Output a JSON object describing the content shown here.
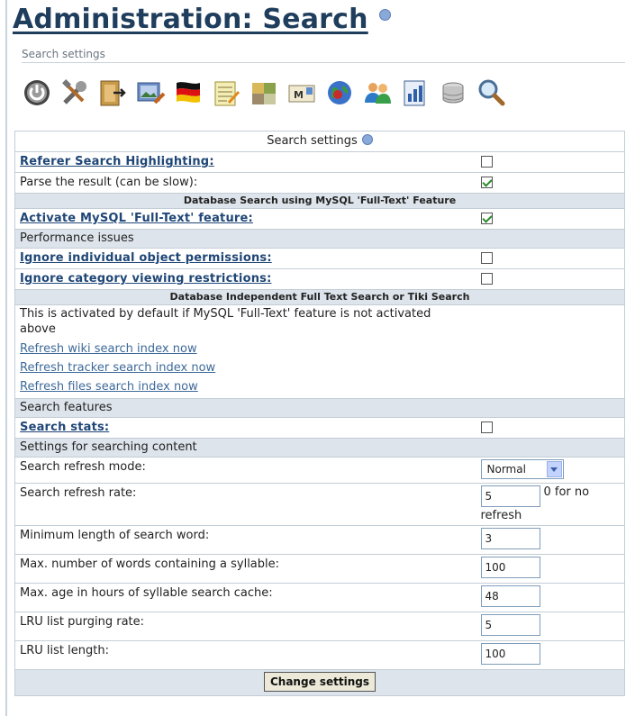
{
  "page": {
    "title": "Administration: Search",
    "subtitle": "Search settings"
  },
  "icon_bar": [
    "power-icon",
    "tools-icon",
    "door-login-icon",
    "image-edit-icon",
    "language-flag-icon",
    "notepad-icon",
    "map-puzzle-icon",
    "mail-icon",
    "globe-icon",
    "users-icon",
    "document-stats-icon",
    "stacked-disks-icon",
    "search-magnifier-icon"
  ],
  "form": {
    "caption": "Search settings",
    "referer_highlighting": {
      "label": "Referer Search Highlighting:",
      "checked": false
    },
    "parse_result": {
      "label": "Parse the result (can be slow):",
      "checked": true
    },
    "mysql_heading": "Database Search using MySQL 'Full-Text' Feature",
    "activate_fulltext": {
      "label": "Activate MySQL 'Full-Text' feature:",
      "checked": true
    },
    "performance_heading": "Performance issues",
    "ignore_object_perms": {
      "label": "Ignore individual object permissions:",
      "checked": false
    },
    "ignore_category_restrictions": {
      "label": "Ignore category viewing restrictions:",
      "checked": false
    },
    "independent_heading": "Database Independent Full Text Search or Tiki Search",
    "independent_note": "This is activated by default if MySQL 'Full-Text' feature is not activated above",
    "refresh_links": [
      "Refresh wiki search index now",
      "Refresh tracker search index now",
      "Refresh files search index now"
    ],
    "features_heading": "Search features",
    "search_stats": {
      "label": "Search stats:",
      "checked": false
    },
    "content_heading": "Settings for searching content",
    "refresh_mode": {
      "label": "Search refresh mode:",
      "value": "Normal"
    },
    "refresh_rate": {
      "label": "Search refresh rate:",
      "value": "5",
      "hint": "0 for no refresh"
    },
    "min_word_length": {
      "label": "Minimum length of search word:",
      "value": "3"
    },
    "max_words_syllable": {
      "label": "Max. number of words containing a syllable:",
      "value": "100"
    },
    "max_age_cache": {
      "label": "Max. age in hours of syllable search cache:",
      "value": "48"
    },
    "lru_purge_rate": {
      "label": "LRU list purging rate:",
      "value": "5"
    },
    "lru_list_length": {
      "label": "LRU list length:",
      "value": "100"
    },
    "submit_label": "Change settings"
  }
}
